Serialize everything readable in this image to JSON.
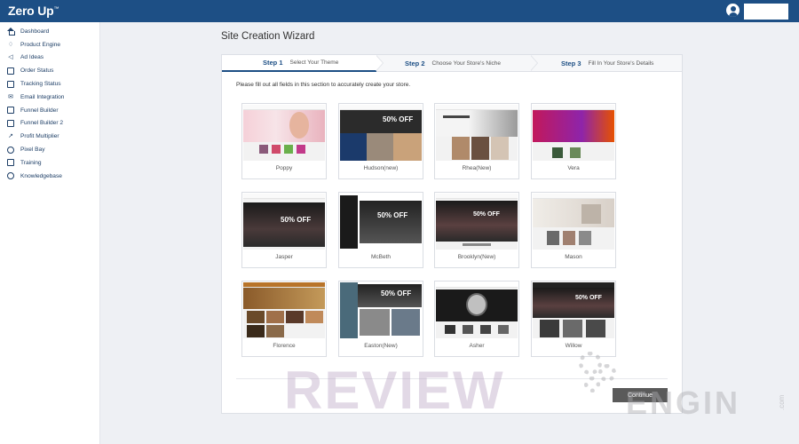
{
  "app": {
    "logo": "Zero Up",
    "logo_mark": "™"
  },
  "sidebar": {
    "items": [
      {
        "label": "Dashboard",
        "icon": "house-icon"
      },
      {
        "label": "Product Engine",
        "icon": "bell-icon"
      },
      {
        "label": "Ad Ideas",
        "icon": "megaphone-icon"
      },
      {
        "label": "Order Status",
        "icon": "box-icon"
      },
      {
        "label": "Tracking Status",
        "icon": "box-icon"
      },
      {
        "label": "Email Integration",
        "icon": "mail-icon"
      },
      {
        "label": "Funnel Builder",
        "icon": "page-icon"
      },
      {
        "label": "Funnel Builder 2",
        "icon": "page-icon"
      },
      {
        "label": "Profit Multiplier",
        "icon": "trend-icon"
      },
      {
        "label": "Pixel Bay",
        "icon": "target-icon"
      },
      {
        "label": "Training",
        "icon": "screen-icon"
      },
      {
        "label": "Knowledgebase",
        "icon": "info-icon"
      }
    ]
  },
  "page": {
    "title": "Site Creation Wizard"
  },
  "wizard": {
    "steps": [
      {
        "number": "Step 1",
        "label": "Select Your Theme"
      },
      {
        "number": "Step 2",
        "label": "Choose Your Store's Niche"
      },
      {
        "number": "Step 3",
        "label": "Fill In Your Store's Details"
      }
    ],
    "instructions": "Please fill out all fields in this section to accurately create your store.",
    "themes": [
      {
        "name": "Poppy"
      },
      {
        "name": "Hudson(new)",
        "offer": "50% OFF"
      },
      {
        "name": "Rhea(New)"
      },
      {
        "name": "Vera"
      },
      {
        "name": "Jasper",
        "offer": "50% OFF"
      },
      {
        "name": "McBeth",
        "offer": "50% OFF"
      },
      {
        "name": "Brooklyn(New)",
        "offer": "50% OFF"
      },
      {
        "name": "Mason"
      },
      {
        "name": "Florence"
      },
      {
        "name": "Easton(New)",
        "offer": "50% OFF"
      },
      {
        "name": "Asher"
      },
      {
        "name": "Willow",
        "offer": "50% OFF"
      }
    ],
    "continue_label": "Continue"
  },
  "watermark": {
    "main": "REVIEW",
    "secondary": "ENGIN",
    "suffix": ".com"
  }
}
